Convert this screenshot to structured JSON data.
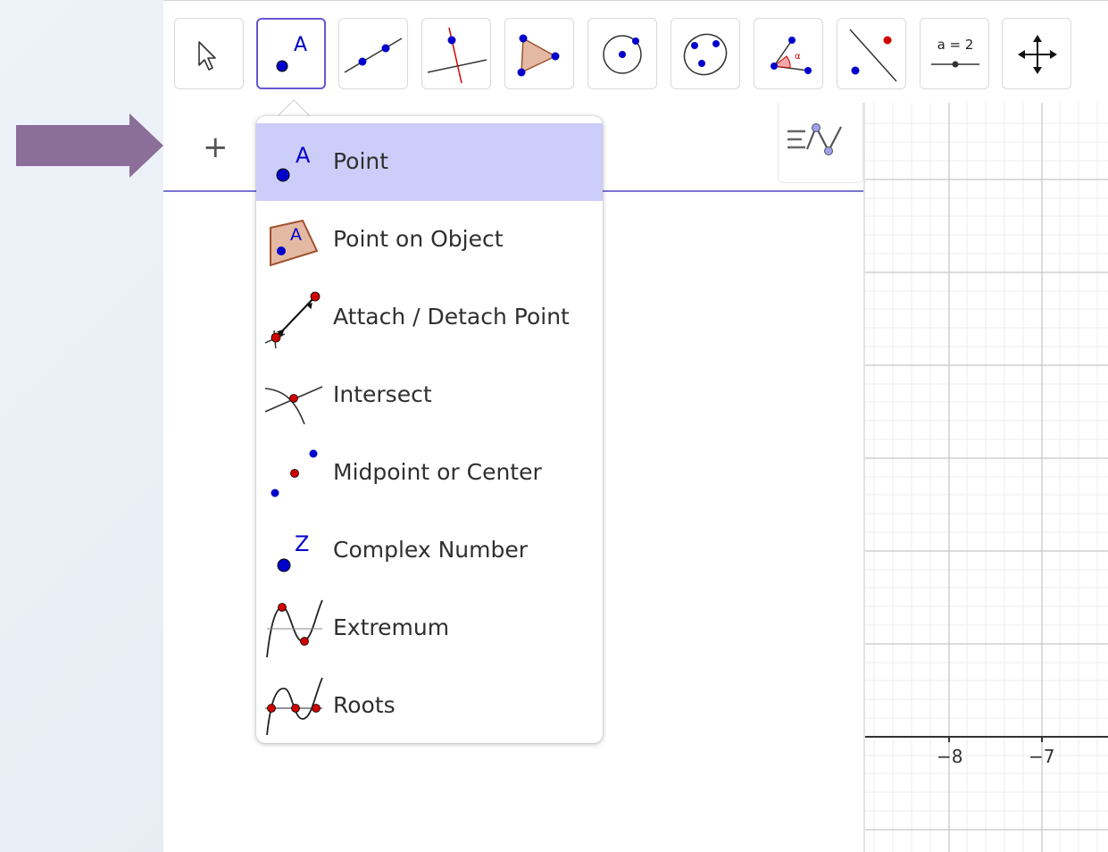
{
  "toolbar": {
    "tools": [
      {
        "name": "move-tool",
        "icon": "arrow-cursor-icon"
      },
      {
        "name": "point-tool",
        "icon": "point-a-icon",
        "label": "A",
        "active": true
      },
      {
        "name": "line-tool",
        "icon": "line-through-two-points-icon"
      },
      {
        "name": "perpendicular-line-tool",
        "icon": "perpendicular-line-icon"
      },
      {
        "name": "polygon-tool",
        "icon": "polygon-icon"
      },
      {
        "name": "circle-tool",
        "icon": "circle-center-point-icon"
      },
      {
        "name": "conic-tool",
        "icon": "conic-five-points-icon"
      },
      {
        "name": "angle-tool",
        "icon": "angle-icon",
        "label": "α"
      },
      {
        "name": "reflect-tool",
        "icon": "reflect-about-line-icon"
      },
      {
        "name": "slider-tool",
        "icon": "slider-icon",
        "label": "a = 2"
      },
      {
        "name": "move-graphics-view-tool",
        "icon": "move-graphics-view-icon"
      }
    ]
  },
  "algebra": {
    "add_label": "+",
    "toggle_icon": "algebra-graphics-toggle-icon"
  },
  "menu": {
    "items": [
      {
        "label": "Point",
        "icon": "point-icon",
        "icon_letter": "A",
        "selected": true
      },
      {
        "label": "Point on Object",
        "icon": "point-on-object-icon",
        "icon_letter": "A"
      },
      {
        "label": "Attach / Detach Point",
        "icon": "attach-detach-point-icon"
      },
      {
        "label": "Intersect",
        "icon": "intersect-icon"
      },
      {
        "label": "Midpoint or Center",
        "icon": "midpoint-icon"
      },
      {
        "label": "Complex Number",
        "icon": "complex-number-icon",
        "icon_letter": "Z"
      },
      {
        "label": "Extremum",
        "icon": "extremum-icon"
      },
      {
        "label": "Roots",
        "icon": "roots-icon"
      }
    ]
  },
  "graphics": {
    "x_tick_labels": [
      "−8",
      "−7"
    ]
  },
  "annotation": {
    "arrow_color": "#8b6e99",
    "icon": "right-arrow-icon"
  },
  "colors": {
    "accent": "#6557d2",
    "selected_bg": "#cdcdf9",
    "point_blue": "#0000cc",
    "point_red": "#d00000"
  }
}
